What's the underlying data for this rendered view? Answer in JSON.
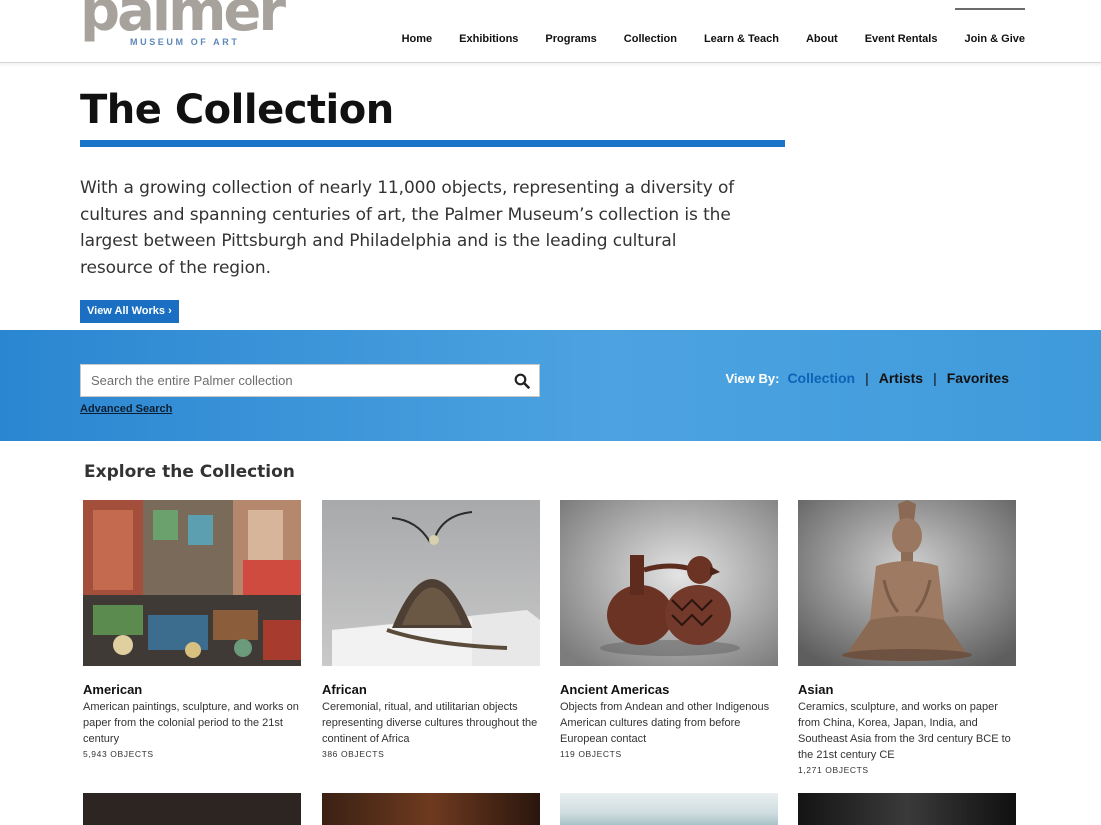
{
  "header": {
    "logo_word": "palmer",
    "logo_sub": "MUSEUM OF ART",
    "nav": [
      "Home",
      "Exhibitions",
      "Programs",
      "Collection",
      "Learn & Teach",
      "About",
      "Event Rentals",
      "Join & Give"
    ]
  },
  "hero": {
    "title": "The Collection",
    "intro": "With a growing collection of nearly 11,000 objects, representing a diversity of cultures and spanning centuries of art, the Palmer Museum’s collection is the largest between Pittsburgh and Philadelphia and is the leading cultural resource of the region.",
    "view_all_label": "View All Works",
    "accent_color": "#1a75c9"
  },
  "search": {
    "placeholder": "Search the entire Palmer collection",
    "value": "",
    "advanced_label": "Advanced Search"
  },
  "view_by": {
    "label": "View By:",
    "options": [
      "Collection",
      "Artists",
      "Favorites"
    ],
    "active": "Collection"
  },
  "explore": {
    "title": "Explore the Collection",
    "cards": [
      {
        "name": "American",
        "desc": "American paintings, sculpture, and works on paper from the colonial period to the 21st century",
        "count": "5,943 OBJECTS"
      },
      {
        "name": "African",
        "desc": "Ceremonial, ritual, and utilitarian objects representing diverse cultures throughout the continent of Africa",
        "count": "386 OBJECTS"
      },
      {
        "name": "Ancient Americas",
        "desc": "Objects from Andean and other Indigenous American cultures dating from before European contact",
        "count": "119 OBJECTS"
      },
      {
        "name": "Asian",
        "desc": "Ceramics, sculpture, and works on paper from China, Korea, Japan, India, and Southeast Asia from the 3rd century BCE to the 21st century CE",
        "count": "1,271 OBJECTS"
      }
    ]
  }
}
